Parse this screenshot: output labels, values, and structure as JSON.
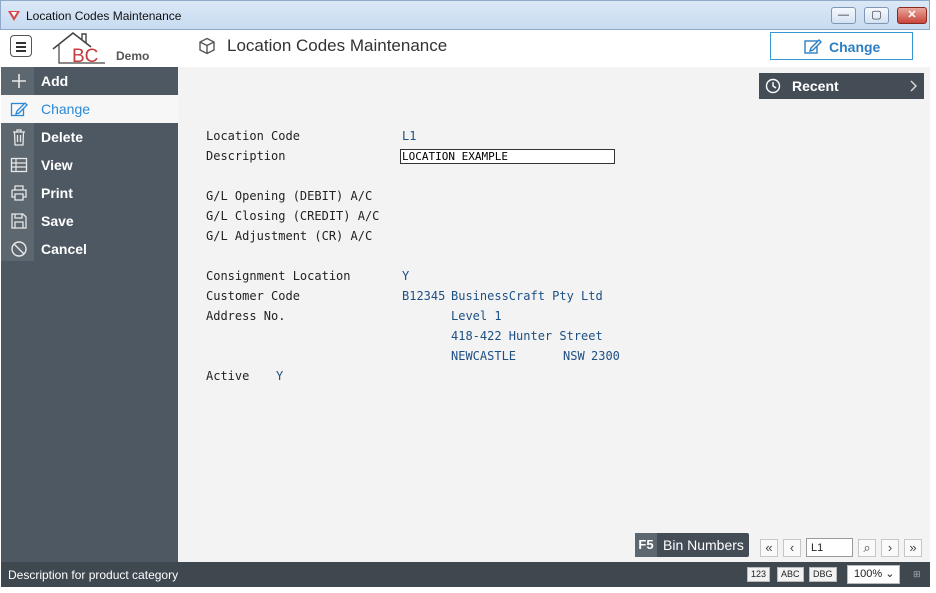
{
  "window": {
    "title": "Location Codes Maintenance",
    "minimize_glyph": "—",
    "maximize_glyph": "▢",
    "close_glyph": "✕"
  },
  "header": {
    "logo_text": "BC",
    "logo_caption": "Demo",
    "page_title": "Location Codes Maintenance",
    "page_icon": "box-icon",
    "change_label": "Change"
  },
  "sidebar": {
    "items": [
      {
        "label": "Add",
        "icon": "plus-icon"
      },
      {
        "label": "Change",
        "icon": "edit-icon"
      },
      {
        "label": "Delete",
        "icon": "trash-icon"
      },
      {
        "label": "View",
        "icon": "table-icon"
      },
      {
        "label": "Print",
        "icon": "printer-icon"
      },
      {
        "label": "Save",
        "icon": "save-icon"
      },
      {
        "label": "Cancel",
        "icon": "cancel-icon"
      }
    ]
  },
  "recent": {
    "label": "Recent"
  },
  "form": {
    "location_code_label": "Location Code",
    "location_code_value": "L1",
    "description_label": "Description",
    "description_value": "LOCATION EXAMPLE",
    "gl_opening_label": "G/L Opening (DEBIT) A/C",
    "gl_closing_label": "G/L Closing (CREDIT) A/C",
    "gl_adjustment_label": "G/L Adjustment (CR) A/C",
    "consignment_label": "Consignment Location",
    "consignment_value": "Y",
    "customer_code_label": "Customer Code",
    "customer_code_value": "B12345",
    "customer_name": "BusinessCraft Pty Ltd",
    "address_no_label": "Address No.",
    "address_line1": "Level 1",
    "address_line2": "418-422 Hunter Street",
    "address_city": "NEWCASTLE",
    "address_state": "NSW",
    "address_postcode": "2300",
    "active_label": "Active",
    "active_value": "Y"
  },
  "footer": {
    "bin_key": "F5",
    "bin_label": "Bin Numbers",
    "record_value": "L1",
    "nav_first": "«",
    "nav_prev": "‹",
    "nav_next": "›",
    "nav_last": "»",
    "search_glyph": "⌕"
  },
  "statusbar": {
    "text": "Description for product category",
    "btn_123": "123",
    "btn_abc": "ABC",
    "btn_dbg": "DBG",
    "zoom": "100%",
    "zoom_arrow": "⌄",
    "grip": "⊞"
  },
  "colors": {
    "sidebar_bg": "#4d5862",
    "accent": "#2b8ad8",
    "value_text": "#1d4f85",
    "status_bg": "#3f474f"
  }
}
